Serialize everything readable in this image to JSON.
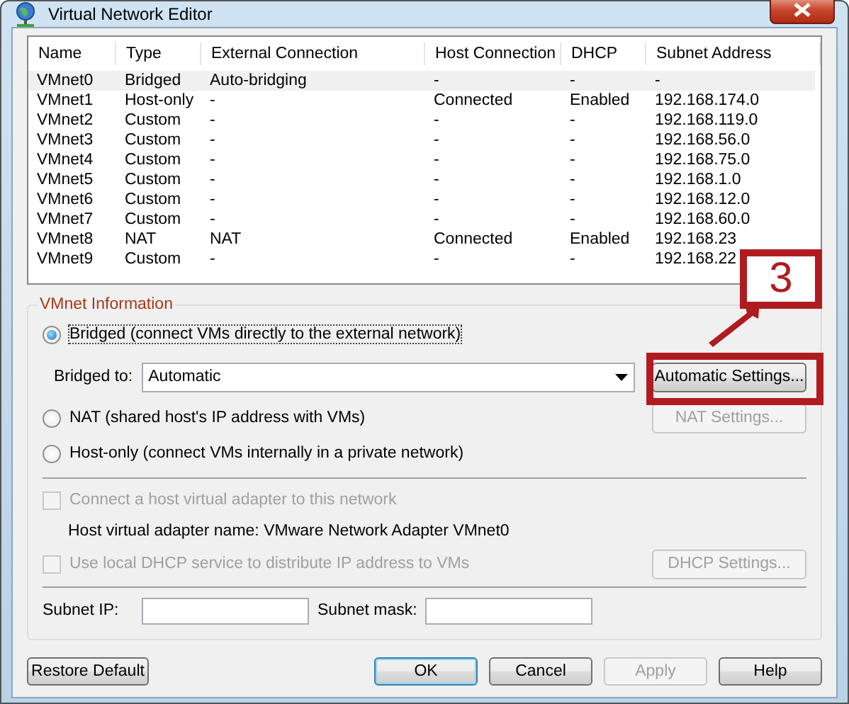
{
  "window": {
    "title": "Virtual Network Editor"
  },
  "table": {
    "columns": [
      "Name",
      "Type",
      "External Connection",
      "Host Connection",
      "DHCP",
      "Subnet Address"
    ],
    "rows": [
      {
        "selected": true,
        "cells": [
          "VMnet0",
          "Bridged",
          "Auto-bridging",
          "-",
          "-",
          "-"
        ]
      },
      {
        "selected": false,
        "cells": [
          "VMnet1",
          "Host-only",
          "-",
          "Connected",
          "Enabled",
          "192.168.174.0"
        ]
      },
      {
        "selected": false,
        "cells": [
          "VMnet2",
          "Custom",
          "-",
          "-",
          "-",
          "192.168.119.0"
        ]
      },
      {
        "selected": false,
        "cells": [
          "VMnet3",
          "Custom",
          "-",
          "-",
          "-",
          "192.168.56.0"
        ]
      },
      {
        "selected": false,
        "cells": [
          "VMnet4",
          "Custom",
          "-",
          "-",
          "-",
          "192.168.75.0"
        ]
      },
      {
        "selected": false,
        "cells": [
          "VMnet5",
          "Custom",
          "-",
          "-",
          "-",
          "192.168.1.0"
        ]
      },
      {
        "selected": false,
        "cells": [
          "VMnet6",
          "Custom",
          "-",
          "-",
          "-",
          "192.168.12.0"
        ]
      },
      {
        "selected": false,
        "cells": [
          "VMnet7",
          "Custom",
          "-",
          "-",
          "-",
          "192.168.60.0"
        ]
      },
      {
        "selected": false,
        "cells": [
          "VMnet8",
          "NAT",
          "NAT",
          "Connected",
          "Enabled",
          "192.168.23"
        ]
      },
      {
        "selected": false,
        "cells": [
          "VMnet9",
          "Custom",
          "-",
          "-",
          "-",
          "192.168.22"
        ]
      }
    ]
  },
  "vmnet_info": {
    "title": "VMnet Information",
    "bridged": {
      "label": "Bridged (connect VMs directly to the external network)",
      "selected": true
    },
    "bridged_to": {
      "label": "Bridged to:",
      "value": "Automatic",
      "button": {
        "label": "Automatic Settings...",
        "disabled": false
      }
    },
    "nat": {
      "label": "NAT (shared host's IP address with VMs)",
      "selected": false,
      "button": {
        "label": "NAT Settings...",
        "disabled": true
      }
    },
    "host_only": {
      "label": "Host-only (connect VMs internally in a private network)",
      "selected": false
    },
    "connect_adapter": {
      "label": "Connect a host virtual adapter to this network",
      "checked": false,
      "disabled": true
    },
    "adapter_name": "Host virtual adapter name: VMware Network Adapter VMnet0",
    "use_dhcp": {
      "label": "Use local DHCP service to distribute IP address to VMs",
      "checked": false,
      "disabled": true,
      "button": {
        "label": "DHCP Settings...",
        "disabled": true
      }
    },
    "subnet_ip": {
      "label": "Subnet IP:"
    },
    "subnet_mask": {
      "label": "Subnet mask:"
    }
  },
  "callout": {
    "number": "3"
  },
  "buttons": [
    {
      "label": "Restore Default",
      "disabled": false,
      "default": false
    },
    {
      "label": "OK",
      "disabled": false,
      "default": true
    },
    {
      "label": "Cancel",
      "disabled": false,
      "default": false
    },
    {
      "label": "Apply",
      "disabled": true,
      "default": false
    },
    {
      "label": "Help",
      "disabled": false,
      "default": false
    }
  ]
}
